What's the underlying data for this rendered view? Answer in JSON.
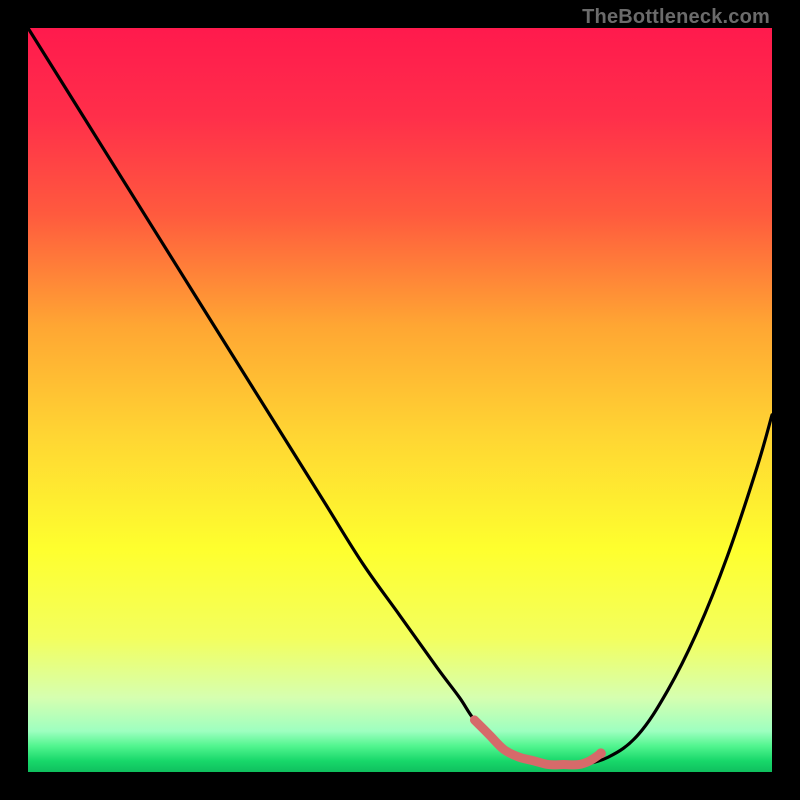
{
  "watermark": "TheBottleneck.com",
  "chart_data": {
    "type": "line",
    "title": "",
    "xlabel": "",
    "ylabel": "",
    "xlim": [
      0,
      100
    ],
    "ylim": [
      0,
      100
    ],
    "background_gradient": {
      "stops": [
        {
          "pos": 0.0,
          "color": "#ff1a4d"
        },
        {
          "pos": 0.12,
          "color": "#ff2f4a"
        },
        {
          "pos": 0.25,
          "color": "#ff5a3e"
        },
        {
          "pos": 0.4,
          "color": "#ffa633"
        },
        {
          "pos": 0.55,
          "color": "#ffd633"
        },
        {
          "pos": 0.7,
          "color": "#feff2e"
        },
        {
          "pos": 0.82,
          "color": "#f3ff5e"
        },
        {
          "pos": 0.9,
          "color": "#d6ffb0"
        },
        {
          "pos": 0.945,
          "color": "#9effc0"
        },
        {
          "pos": 0.965,
          "color": "#52f58f"
        },
        {
          "pos": 0.985,
          "color": "#18d86a"
        },
        {
          "pos": 1.0,
          "color": "#0fbf5e"
        }
      ]
    },
    "series": [
      {
        "name": "bottleneck-curve",
        "color": "#000000",
        "x": [
          0,
          5,
          10,
          15,
          20,
          25,
          30,
          35,
          40,
          45,
          50,
          55,
          58,
          60,
          63,
          66,
          70,
          74,
          78,
          82,
          86,
          90,
          94,
          98,
          100
        ],
        "values": [
          100,
          92,
          84,
          76,
          68,
          60,
          52,
          44,
          36,
          28,
          21,
          14,
          10,
          7,
          4,
          2,
          1,
          1,
          2,
          5,
          11,
          19,
          29,
          41,
          48
        ]
      }
    ],
    "highlight": {
      "name": "optimal-range",
      "color": "#d66a6a",
      "points": [
        {
          "x": 60,
          "y": 7
        },
        {
          "x": 62,
          "y": 5
        },
        {
          "x": 64,
          "y": 3
        },
        {
          "x": 66,
          "y": 2
        },
        {
          "x": 68,
          "y": 1.5
        },
        {
          "x": 70,
          "y": 1
        },
        {
          "x": 72,
          "y": 1
        },
        {
          "x": 74,
          "y": 1
        },
        {
          "x": 75.5,
          "y": 1.5
        },
        {
          "x": 77,
          "y": 2.5
        }
      ],
      "end_marker": {
        "x": 77,
        "y": 2.5,
        "r": 5
      }
    }
  }
}
